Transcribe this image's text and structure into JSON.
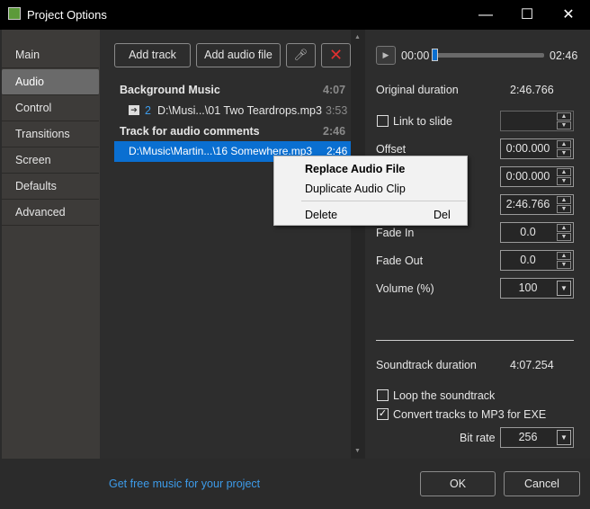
{
  "window": {
    "title": "Project Options",
    "minimize": "—",
    "maximize": "☐",
    "close": "✕"
  },
  "sidebar": {
    "items": [
      {
        "label": "Main"
      },
      {
        "label": "Audio"
      },
      {
        "label": "Control"
      },
      {
        "label": "Transitions"
      },
      {
        "label": "Screen"
      },
      {
        "label": "Defaults"
      },
      {
        "label": "Advanced"
      }
    ],
    "active": "Audio"
  },
  "toolbar": {
    "add_track": "Add track",
    "add_audio_file": "Add audio file",
    "mic_icon": "microphone-icon",
    "delete_icon": "red-x-icon"
  },
  "tracks": [
    {
      "name": "Background Music",
      "duration": "4:07",
      "files": [
        {
          "index": "2",
          "path": "D:\\Musi...\\01 Two Teardrops.mp3",
          "duration": "3:53"
        }
      ]
    },
    {
      "name": "Track for audio comments",
      "duration": "2:46",
      "files": [
        {
          "path": "D:\\Music\\Martin...\\16 Somewhere.mp3",
          "duration": "2:46",
          "selected": true
        }
      ]
    }
  ],
  "context_menu": {
    "replace": "Replace Audio File",
    "duplicate": "Duplicate Audio Clip",
    "delete": "Delete",
    "delete_shortcut": "Del"
  },
  "player": {
    "position": "00:00",
    "total": "02:46",
    "progress": 0
  },
  "props": {
    "original_duration_label": "Original duration",
    "original_duration": "2:46.766",
    "link_label": "Link to slide",
    "link_checked": false,
    "offset_label": "Offset",
    "offset": "0:00.000",
    "field2": "0:00.000",
    "field3": "2:46.766",
    "fade_in_label": "Fade In",
    "fade_in": "0.0",
    "fade_out_label": "Fade Out",
    "fade_out": "0.0",
    "volume_label": "Volume (%)",
    "volume": "100",
    "soundtrack_label": "Soundtrack duration",
    "soundtrack": "4:07.254",
    "loop_label": "Loop the soundtrack",
    "loop_checked": false,
    "convert_label": "Convert tracks to MP3 for EXE",
    "convert_checked": true,
    "bitrate_label": "Bit rate",
    "bitrate": "256"
  },
  "footer": {
    "link": "Get free music for your project",
    "ok": "OK",
    "cancel": "Cancel"
  },
  "colors": {
    "selection": "#0a6fd1",
    "link": "#3d9be9",
    "delete": "#e03030"
  }
}
